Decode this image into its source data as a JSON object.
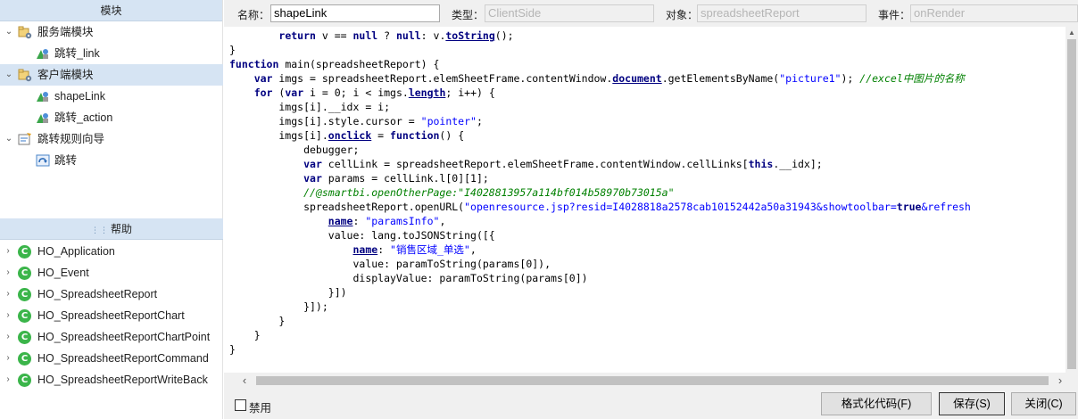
{
  "left_panel": {
    "modules_header": "模块",
    "module_tree": [
      {
        "label": "服务端模块",
        "level": 0,
        "expanded": true,
        "icon": "folder-gear-icon",
        "selected": false
      },
      {
        "label": "跳转_link",
        "level": 1,
        "icon": "shape-link-icon",
        "selected": false
      },
      {
        "label": "客户端模块",
        "level": 0,
        "expanded": true,
        "icon": "folder-gear-icon",
        "selected": true
      },
      {
        "label": "shapeLink",
        "level": 1,
        "icon": "shape-link-icon",
        "selected": false
      },
      {
        "label": "跳转_action",
        "level": 1,
        "icon": "shape-link-icon",
        "selected": false
      },
      {
        "label": "跳转规则向导",
        "level": 0,
        "expanded": true,
        "icon": "wizard-icon",
        "selected": false
      },
      {
        "label": "跳转",
        "level": 1,
        "icon": "jump-icon",
        "selected": false
      }
    ],
    "help_header": "帮助",
    "help_tree": [
      "HO_Application",
      "HO_Event",
      "HO_SpreadsheetReport",
      "HO_SpreadsheetReportChart",
      "HO_SpreadsheetReportChartPoint",
      "HO_SpreadsheetReportCommand",
      "HO_SpreadsheetReportWriteBack"
    ],
    "class_icon_letter": "C"
  },
  "topbar": {
    "name_label": "名称：",
    "name_value": "shapeLink",
    "type_label": "类型：",
    "type_value": "ClientSide",
    "object_label": "对象：",
    "object_value": "spreadsheetReport",
    "event_label": "事件：",
    "event_value": "onRender"
  },
  "editor": {
    "lines": [
      [
        {
          "t": "        "
        },
        {
          "t": "return",
          "c": "kw"
        },
        {
          "t": " v == "
        },
        {
          "t": "null",
          "c": "kw"
        },
        {
          "t": " ? "
        },
        {
          "t": "null",
          "c": "kw"
        },
        {
          "t": ": v."
        },
        {
          "t": "toString",
          "c": "prop"
        },
        {
          "t": "();"
        }
      ],
      [
        {
          "t": "}"
        }
      ],
      [
        {
          "t": "function",
          "c": "kw"
        },
        {
          "t": " main(spreadsheetReport) {"
        }
      ],
      [
        {
          "t": "    "
        },
        {
          "t": "var",
          "c": "kw"
        },
        {
          "t": " imgs = spreadsheetReport.elemSheetFrame.contentWindow."
        },
        {
          "t": "document",
          "c": "prop"
        },
        {
          "t": ".getElementsByName("
        },
        {
          "t": "\"picture1\"",
          "c": "str"
        },
        {
          "t": "); "
        },
        {
          "t": "//excel中图片的名称",
          "c": "cmt"
        }
      ],
      [
        {
          "t": "    "
        },
        {
          "t": "for",
          "c": "kw"
        },
        {
          "t": " ("
        },
        {
          "t": "var",
          "c": "kw"
        },
        {
          "t": " i = 0; i < imgs."
        },
        {
          "t": "length",
          "c": "prop"
        },
        {
          "t": "; i++) {"
        }
      ],
      [
        {
          "t": "        imgs[i].__idx = i;"
        }
      ],
      [
        {
          "t": "        imgs[i].style.cursor = "
        },
        {
          "t": "\"pointer\"",
          "c": "str"
        },
        {
          "t": ";"
        }
      ],
      [
        {
          "t": "        imgs[i]."
        },
        {
          "t": "onclick",
          "c": "prop"
        },
        {
          "t": " = "
        },
        {
          "t": "function",
          "c": "kw"
        },
        {
          "t": "() {"
        }
      ],
      [
        {
          "t": "            debugger;"
        }
      ],
      [
        {
          "t": "            "
        },
        {
          "t": "var",
          "c": "kw"
        },
        {
          "t": " cellLink = spreadsheetReport.elemSheetFrame.contentWindow.cellLinks["
        },
        {
          "t": "this",
          "c": "kw"
        },
        {
          "t": ".__idx];"
        }
      ],
      [
        {
          "t": "            "
        },
        {
          "t": "var",
          "c": "kw"
        },
        {
          "t": " params = cellLink.l[0][1];"
        }
      ],
      [
        {
          "t": "            "
        },
        {
          "t": "//@smartbi.openOtherPage:\"I4028813957a114bf014b58970b73015a\"",
          "c": "cmt"
        }
      ],
      [
        {
          "t": "            spreadsheetReport.openURL("
        },
        {
          "t": "\"openresource.jsp?resid=I4028818a2578cab10152442a50a31943&showtoolbar=",
          "c": "str"
        },
        {
          "t": "true",
          "c": "kw"
        },
        {
          "t": "&refresh",
          "c": "str"
        }
      ],
      [
        {
          "t": "                "
        },
        {
          "t": "name",
          "c": "prop"
        },
        {
          "t": ": "
        },
        {
          "t": "\"paramsInfo\"",
          "c": "str"
        },
        {
          "t": ","
        }
      ],
      [
        {
          "t": "                value: lang.toJSONString([{"
        }
      ],
      [
        {
          "t": "                    "
        },
        {
          "t": "name",
          "c": "prop"
        },
        {
          "t": ": "
        },
        {
          "t": "\"销售区域_单选\"",
          "c": "str"
        },
        {
          "t": ","
        }
      ],
      [
        {
          "t": "                    value: paramToString(params[0]),"
        }
      ],
      [
        {
          "t": "                    displayValue: paramToString(params[0])"
        }
      ],
      [
        {
          "t": "                }])"
        }
      ],
      [
        {
          "t": "            }]);"
        }
      ],
      [
        {
          "t": "        }"
        }
      ],
      [
        {
          "t": "    }"
        }
      ],
      [
        {
          "t": "}"
        }
      ]
    ]
  },
  "bottombar": {
    "disable_label": "禁用",
    "format_button": "格式化代码(F)",
    "save_button": "保存(S)",
    "close_button": "关闭(C)"
  }
}
